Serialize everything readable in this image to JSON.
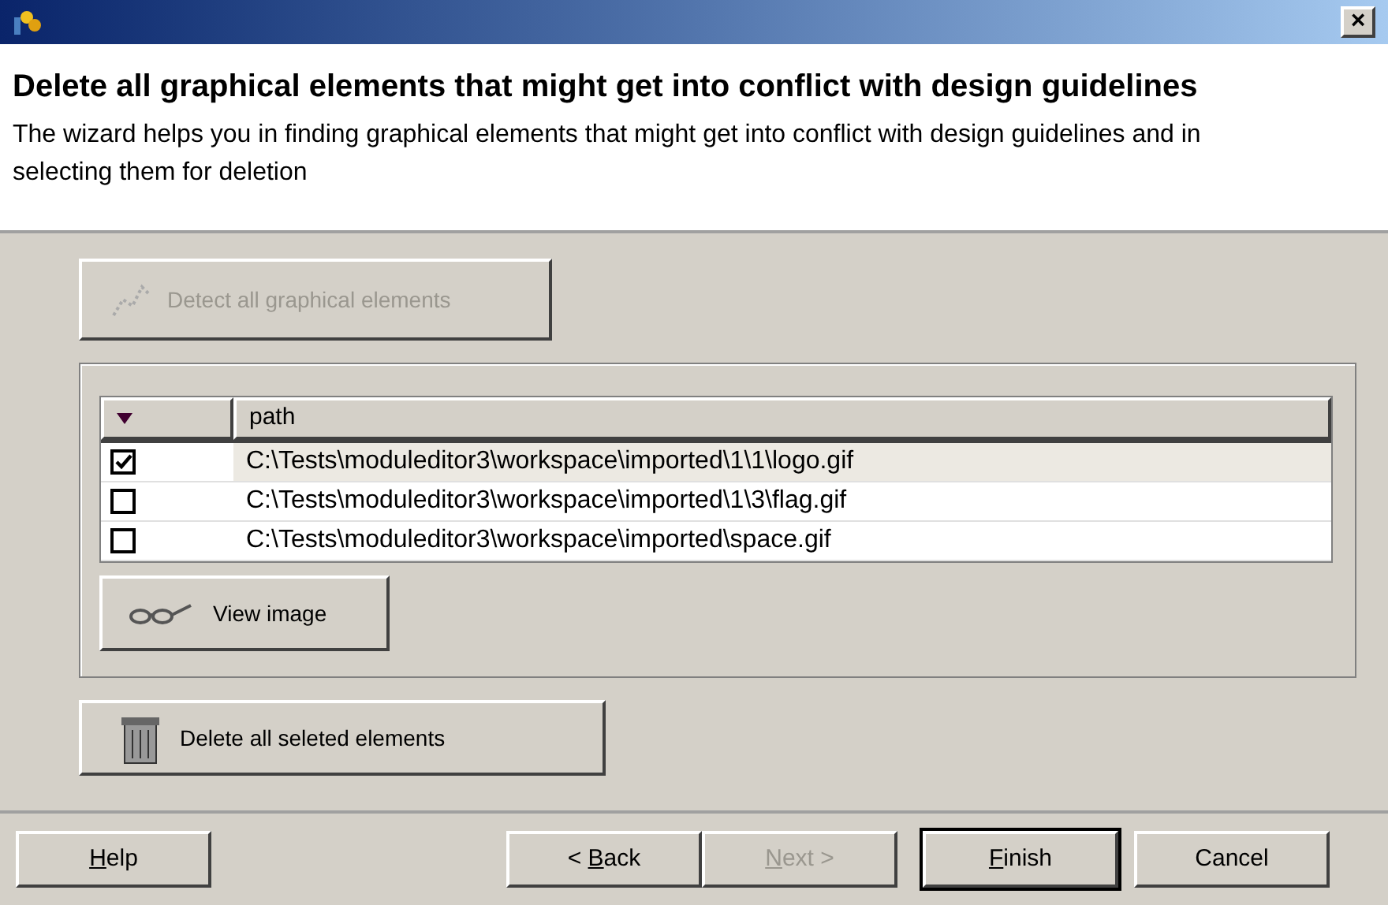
{
  "window": {
    "close": "×"
  },
  "header": {
    "title": "Delete all graphical elements that might get into conflict with design guidelines",
    "description": "The wizard helps you in finding graphical elements that might get into conflict with design guidelines and in selecting them for deletion"
  },
  "detect_button": {
    "label": "Detect all graphical elements",
    "disabled": true
  },
  "table": {
    "columns": [
      "path"
    ],
    "rows": [
      {
        "checked": true,
        "selected": true,
        "path": "C:\\Tests\\moduleditor3\\workspace\\imported\\1\\1\\logo.gif"
      },
      {
        "checked": false,
        "selected": false,
        "path": "C:\\Tests\\moduleditor3\\workspace\\imported\\1\\3\\flag.gif"
      },
      {
        "checked": false,
        "selected": false,
        "path": "C:\\Tests\\moduleditor3\\workspace\\imported\\space.gif"
      }
    ]
  },
  "view_button": {
    "label": "View image"
  },
  "delete_button": {
    "label": "Delete all seleted elements"
  },
  "footer_buttons": [
    {
      "parts": [
        {
          "text": "H",
          "underline": true
        },
        {
          "text": "elp",
          "underline": false
        }
      ],
      "disabled": false,
      "default": false
    },
    {
      "parts": [
        {
          "text": "< ",
          "underline": false
        },
        {
          "text": "B",
          "underline": true
        },
        {
          "text": "ack",
          "underline": false
        }
      ],
      "disabled": false,
      "default": false
    },
    {
      "parts": [
        {
          "text": "N",
          "underline": true
        },
        {
          "text": "ext >",
          "underline": false
        }
      ],
      "disabled": true,
      "default": false
    },
    {
      "parts": [
        {
          "text": "F",
          "underline": true
        },
        {
          "text": "inish",
          "underline": false
        }
      ],
      "disabled": false,
      "default": true
    },
    {
      "parts": [
        {
          "text": "Cancel",
          "underline": false
        }
      ],
      "disabled": false,
      "default": false
    }
  ]
}
